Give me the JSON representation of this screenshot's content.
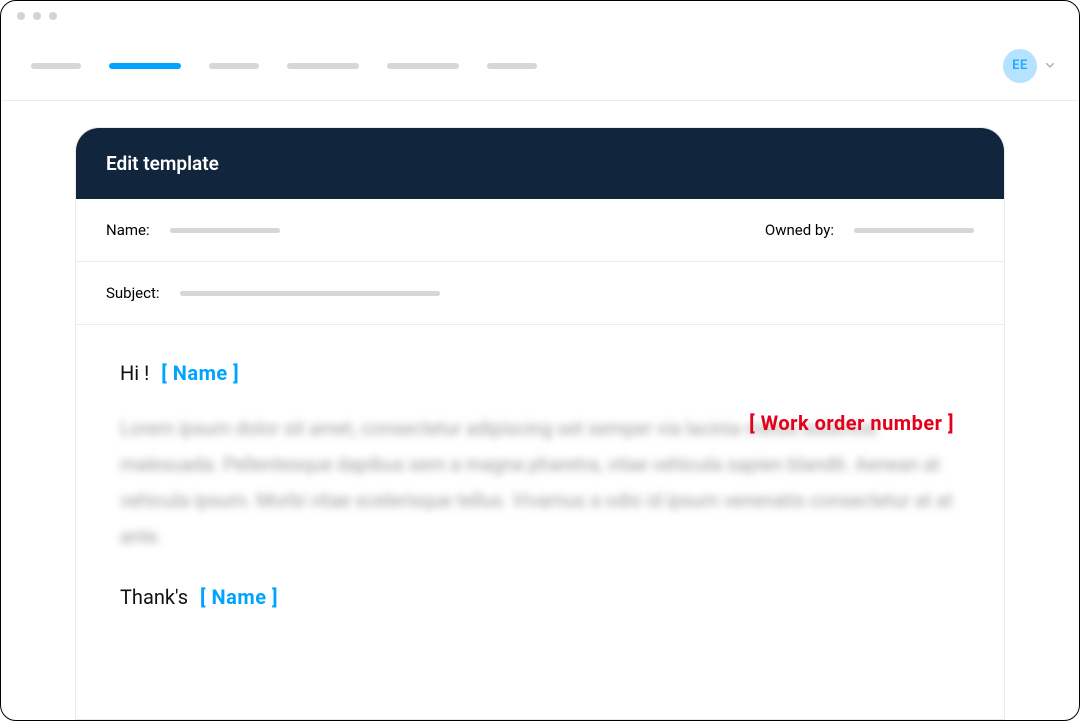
{
  "avatar": {
    "initials": "EE"
  },
  "card": {
    "title": "Edit template"
  },
  "fields": {
    "name_label": "Name:",
    "owned_by_label": "Owned by:",
    "subject_label": "Subject:"
  },
  "body": {
    "greeting": "Hi !",
    "greeting_merge": "[ Name ]",
    "paragraph_placeholder": "Lorem ipsum dolor sit amet, consectetur adipiscing set semper via lacinia metus euismod malesuada. Pellentesque dapibus sem a magna pharetra, vitae vehicula sapien blandit. Aenean at vehicula ipsum. Morbi vitae scelerisque tellus. Vivamus a odio id ipsum venenatis consectetur at at ante.",
    "work_order_merge": "[ Work order number ]",
    "closing": "Thank's",
    "closing_merge": "[ Name ]"
  }
}
